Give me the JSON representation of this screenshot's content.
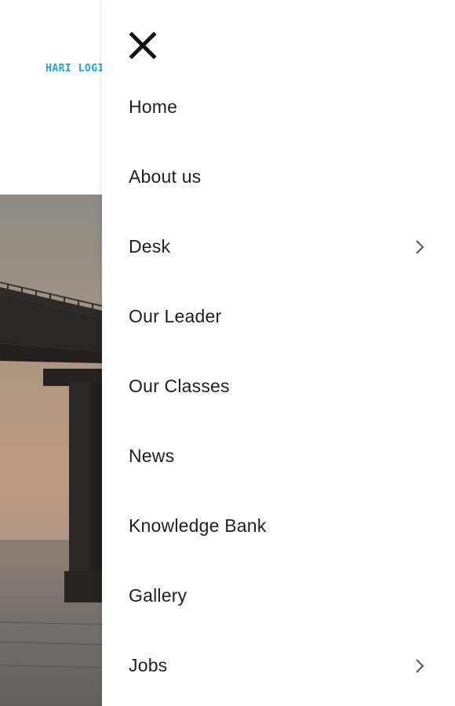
{
  "background": {
    "logo_text": "HARI LOGIS"
  },
  "drawer": {
    "close_icon": "close-icon",
    "items": [
      {
        "label": "Home",
        "has_submenu": false
      },
      {
        "label": "About us",
        "has_submenu": false
      },
      {
        "label": "Desk",
        "has_submenu": true
      },
      {
        "label": "Our Leader",
        "has_submenu": false
      },
      {
        "label": "Our Classes",
        "has_submenu": false
      },
      {
        "label": "News",
        "has_submenu": false
      },
      {
        "label": "Knowledge Bank",
        "has_submenu": false
      },
      {
        "label": "Gallery",
        "has_submenu": false
      },
      {
        "label": "Jobs",
        "has_submenu": true
      }
    ]
  },
  "colors": {
    "logo": "#1fa6d8",
    "menu_text": "#1e1e1e",
    "chevron": "#555555"
  }
}
